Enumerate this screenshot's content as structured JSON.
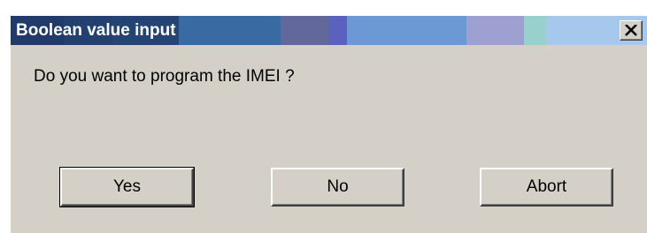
{
  "window": {
    "title": "Boolean value input",
    "close_icon": "close-icon",
    "colors": {
      "face": "#d4d0c8",
      "title_text": "#ffffff"
    }
  },
  "message": "Do you want to program the IMEI ?",
  "buttons": {
    "yes_label": "Yes",
    "no_label": "No",
    "abort_label": "Abort"
  }
}
